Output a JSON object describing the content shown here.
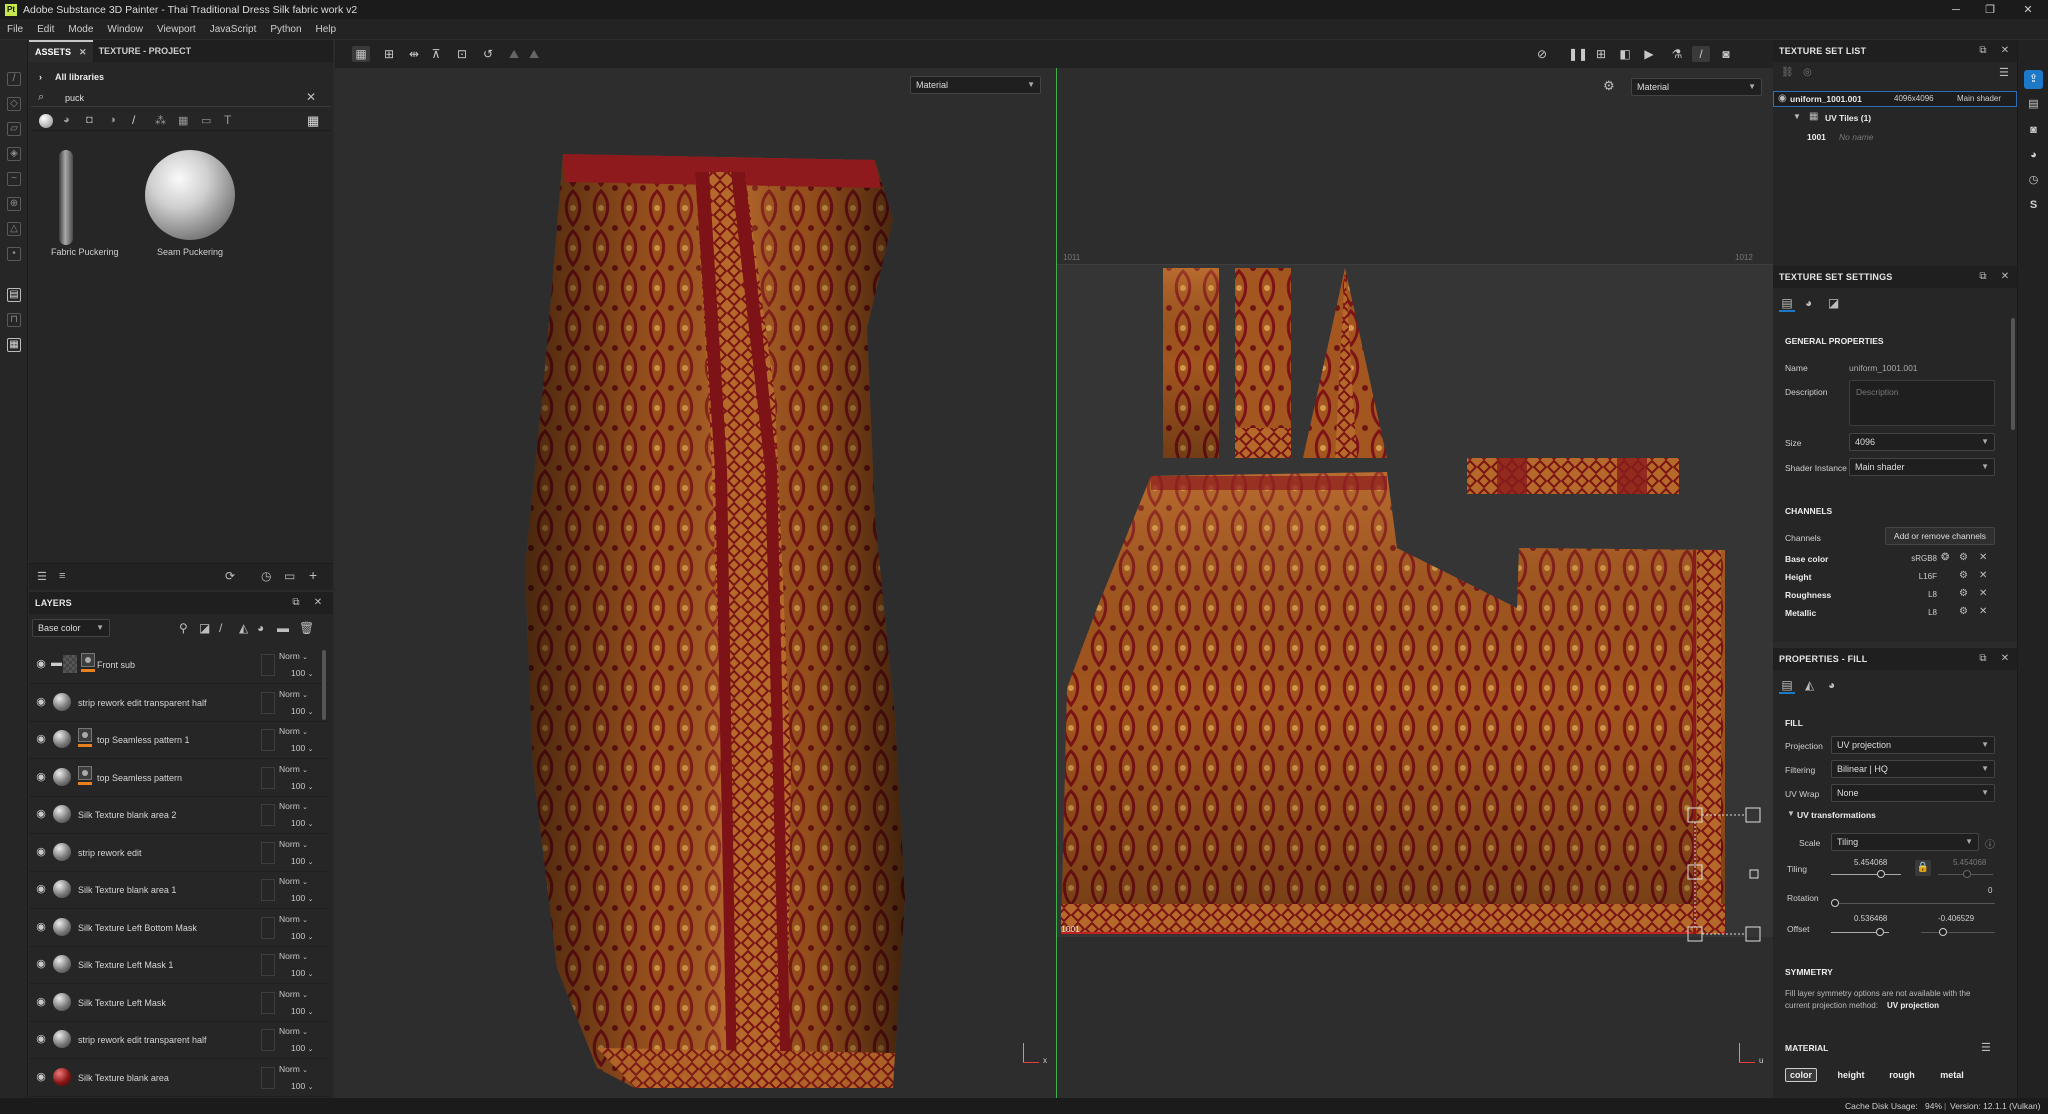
{
  "window": {
    "title": "Adobe Substance 3D Painter - Thai Traditional Dress Silk fabric work v2",
    "logo": "Pt"
  },
  "menu": [
    "File",
    "Edit",
    "Mode",
    "Window",
    "Viewport",
    "JavaScript",
    "Python",
    "Help"
  ],
  "assets": {
    "tabs": [
      "ASSETS",
      "TEXTURE - PROJECT"
    ],
    "breadcrumb": "All libraries",
    "search_value": "puck",
    "items": [
      {
        "label": "Fabric Puckering"
      },
      {
        "label": "Seam Puckering"
      }
    ]
  },
  "layers": {
    "title": "LAYERS",
    "channel": "Base color",
    "items": [
      {
        "name": "Front sub",
        "blend": "Norm",
        "opacity": "100",
        "folder": true,
        "mask": true
      },
      {
        "name": "strip rework edit transparent half",
        "blend": "Norm",
        "opacity": "100"
      },
      {
        "name": "top Seamless pattern 1",
        "blend": "Norm",
        "opacity": "100",
        "mask": true
      },
      {
        "name": "top Seamless pattern",
        "blend": "Norm",
        "opacity": "100",
        "mask": true
      },
      {
        "name": "Silk Texture blank area 2",
        "blend": "Norm",
        "opacity": "100"
      },
      {
        "name": "strip rework edit",
        "blend": "Norm",
        "opacity": "100"
      },
      {
        "name": "Silk Texture blank area 1",
        "blend": "Norm",
        "opacity": "100"
      },
      {
        "name": "Silk Texture Left Bottom Mask",
        "blend": "Norm",
        "opacity": "100"
      },
      {
        "name": "Silk Texture Left Mask 1",
        "blend": "Norm",
        "opacity": "100"
      },
      {
        "name": "Silk Texture Left Mask",
        "blend": "Norm",
        "opacity": "100"
      },
      {
        "name": "strip rework edit transparent half",
        "blend": "Norm",
        "opacity": "100"
      },
      {
        "name": "Silk Texture blank area",
        "blend": "Norm",
        "opacity": "100",
        "red": true
      }
    ]
  },
  "viewport": {
    "left_mode": "Material",
    "right_mode": "Material",
    "uv_tiles": {
      "tile_label": "1001",
      "top_left": "1011",
      "top_right": "1012"
    },
    "axis_x": "x",
    "axis_u": "u"
  },
  "texture_set_list": {
    "title": "TEXTURE SET LIST",
    "item": {
      "name": "uniform_1001.001",
      "size": "4096x4096",
      "shader": "Main shader"
    },
    "uv_tiles": "UV Tiles (1)",
    "tile": {
      "id": "1001",
      "name": "No name"
    }
  },
  "texture_set_settings": {
    "title": "TEXTURE SET SETTINGS",
    "general_title": "GENERAL PROPERTIES",
    "name_label": "Name",
    "name_value": "uniform_1001.001",
    "description_label": "Description",
    "description_placeholder": "Description",
    "size_label": "Size",
    "size_value": "4096",
    "shader_label": "Shader Instance",
    "shader_value": "Main shader",
    "channels_title": "CHANNELS",
    "channels_label": "Channels",
    "add_remove": "Add or remove channels",
    "channels": [
      {
        "name": "Base color",
        "format": "sRGB8"
      },
      {
        "name": "Height",
        "format": "L16F"
      },
      {
        "name": "Roughness",
        "format": "L8"
      },
      {
        "name": "Metallic",
        "format": "L8"
      }
    ]
  },
  "properties": {
    "title": "PROPERTIES - FILL",
    "fill_title": "FILL",
    "projection_label": "Projection",
    "projection_value": "UV projection",
    "filtering_label": "Filtering",
    "filtering_value": "Bilinear | HQ",
    "uvwrap_label": "UV Wrap",
    "uvwrap_value": "None",
    "uvt_title": "UV transformations",
    "scale_label": "Scale",
    "scale_value": "Tiling",
    "tiling_label": "Tiling",
    "tiling_u": "5.454068",
    "tiling_v": "5.454068",
    "rotation_label": "Rotation",
    "rotation_value": "0",
    "offset_label": "Offset",
    "offset_u": "0.536468",
    "offset_v": "-0.406529",
    "symmetry_title": "SYMMETRY",
    "symmetry_line1": "Fill layer symmetry options are not available with the",
    "symmetry_line2": "current projection method:",
    "symmetry_method": "UV projection",
    "material_title": "MATERIAL",
    "material_chips": [
      "color",
      "height",
      "rough",
      "metal"
    ]
  },
  "status": {
    "cache": "Cache Disk Usage:",
    "cache_value": "94%",
    "version": "Version: 12.1.1 (Vulkan)"
  },
  "colors": {
    "silk_gold": "#b5692a",
    "silk_red": "#8a1a1c",
    "accent_orange": "#e7801d",
    "accent_blue": "#1e78c8"
  }
}
